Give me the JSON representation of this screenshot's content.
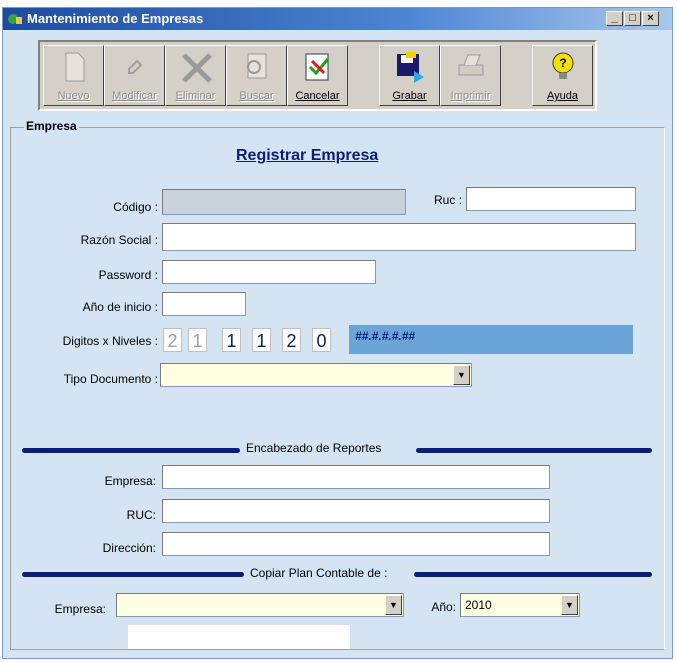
{
  "window": {
    "title": "Mantenimiento de Empresas"
  },
  "toolbar": {
    "buttons": [
      {
        "label": "Nuevo",
        "icon": "new-document-icon",
        "enabled": false
      },
      {
        "label": "Modificar",
        "icon": "pencil-icon",
        "enabled": false
      },
      {
        "label": "Eliminar",
        "icon": "x-delete-icon",
        "enabled": false
      },
      {
        "label": "Buscar",
        "icon": "search-document-icon",
        "enabled": false
      },
      {
        "label": "Cancelar",
        "icon": "cancel-check-icon",
        "enabled": true
      },
      {
        "label": "Grabar",
        "icon": "save-floppy-icon",
        "enabled": true
      },
      {
        "label": "Imprimir",
        "icon": "printer-icon",
        "enabled": false
      },
      {
        "label": "Ayuda",
        "icon": "help-bulb-icon",
        "enabled": true
      }
    ]
  },
  "group": {
    "label": "Empresa",
    "heading": "Registrar Empresa",
    "codigo_label": "Código :",
    "ruc_label": "Ruc :",
    "razon_label": "Razón Social :",
    "password_label": "Password :",
    "anio_inicio_label": "Año de inicio :",
    "digitos_label": "Digitos x Niveles :",
    "digitos": [
      "2",
      "1",
      "1",
      "1",
      "2",
      "0"
    ],
    "mask": "##.#.#.#.##",
    "tipo_doc_label": "Tipo Documento :"
  },
  "reportes": {
    "title": "Encabezado de Reportes",
    "empresa_label": "Empresa:",
    "ruc_label": "RUC:",
    "direccion_label": "Dirección:"
  },
  "copiar": {
    "title": "Copiar Plan Contable de :",
    "empresa_label": "Empresa:",
    "anio_label": "Año:",
    "anio_value": "2010"
  },
  "colors": {
    "accent": "#0a1e73",
    "background": "#d4e4f3",
    "mask_bg": "#6ba5d8"
  }
}
